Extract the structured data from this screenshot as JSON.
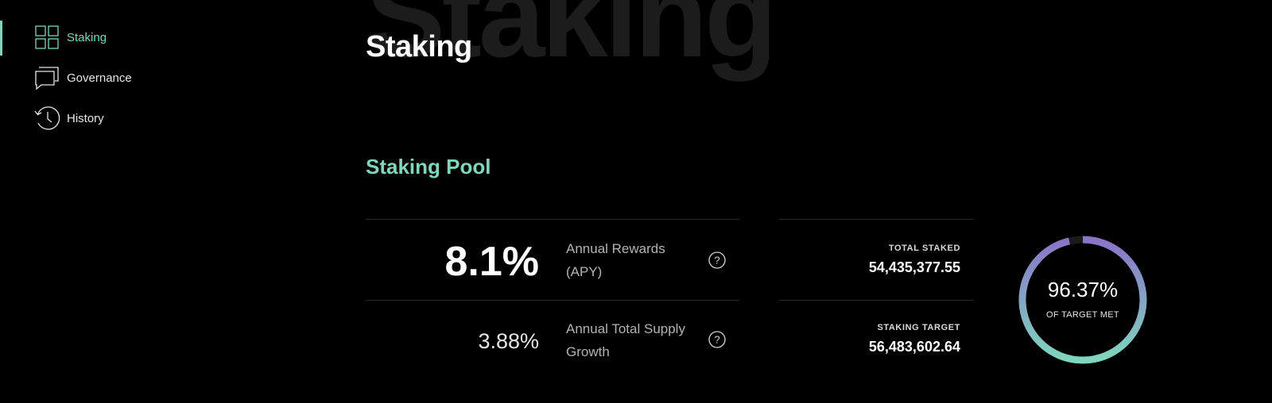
{
  "page": {
    "watermark": "Staking",
    "title": "Staking"
  },
  "sidebar": {
    "items": [
      {
        "label": "Staking",
        "icon": "grid-icon",
        "active": true
      },
      {
        "label": "Governance",
        "icon": "chat-bubbles-icon",
        "active": false
      },
      {
        "label": "History",
        "icon": "history-clock-icon",
        "active": false
      }
    ]
  },
  "pool": {
    "title": "Staking Pool",
    "apy_value": "8.1%",
    "apy_label": "Annual Rewards (APY)",
    "supply_value": "3.88%",
    "supply_label": "Annual Total Supply Growth",
    "total_staked_label": "TOTAL STAKED",
    "total_staked_value": "54,435,377.55",
    "target_label": "STAKING TARGET",
    "target_value": "56,483,602.64",
    "gauge_percent": "96.37%",
    "gauge_fraction": 0.9637,
    "gauge_caption": "OF TARGET MET"
  },
  "colors": {
    "accent": "#7fd6bd",
    "gauge_start": "#7fd6bd",
    "gauge_end": "#8a74c9",
    "background": "#000000"
  }
}
